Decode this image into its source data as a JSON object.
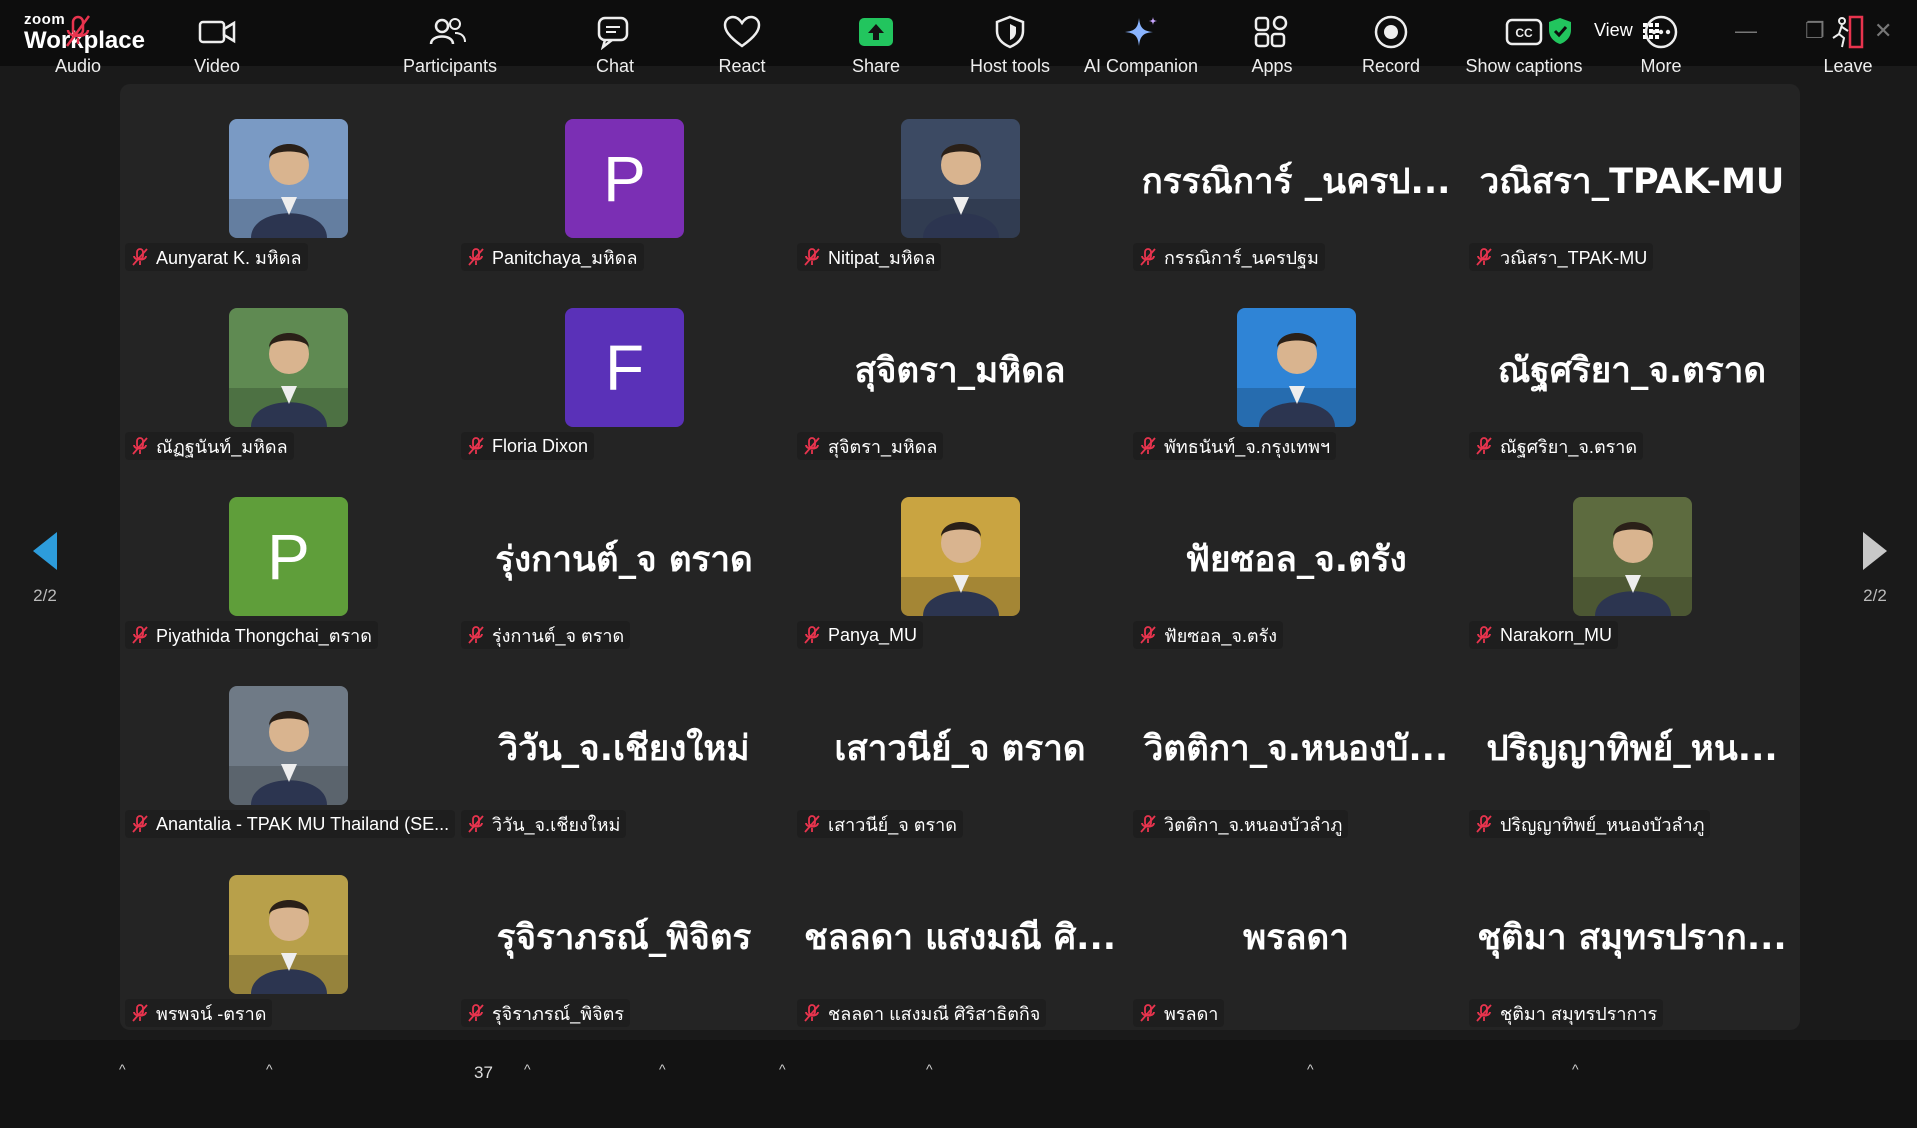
{
  "titlebar": {
    "logo_top": "zoom",
    "logo_bottom": "Workplace",
    "view_label": "View",
    "minimize": "—",
    "maximize": "❐",
    "close": "✕"
  },
  "pager": {
    "left_label": "2/2",
    "right_label": "2/2"
  },
  "participants": [
    {
      "name": "Aunyarat K. มหิดล",
      "display": "photo",
      "photo_color": "#7a9ac4"
    },
    {
      "name": "Panitchaya_มหิดล",
      "display": "letter",
      "letter": "P",
      "color": "#7b2fb4"
    },
    {
      "name": "Nitipat_มหิดล",
      "display": "photo",
      "photo_color": "#3c4a63"
    },
    {
      "name": "กรรณิการ์_นครปฐม",
      "display": "text",
      "big": "กรรณิการ์ _นครป..."
    },
    {
      "name": "วณิสรา_TPAK-MU",
      "display": "text",
      "big": "วณิสรา_TPAK-MU"
    },
    {
      "name": "ณัฏฐนันท์_มหิดล",
      "display": "photo",
      "photo_color": "#5f8a52"
    },
    {
      "name": "Floria Dixon",
      "display": "letter",
      "letter": "F",
      "color": "#5a31b8"
    },
    {
      "name": "สุจิตรา_มหิดล",
      "display": "text",
      "big": "สุจิตรา_มหิดล"
    },
    {
      "name": "พัทธนันท์_จ.กรุงเทพฯ",
      "display": "photo",
      "photo_color": "#2f84d6"
    },
    {
      "name": "ณัฐศริยา_จ.ตราด",
      "display": "text",
      "big": "ณัฐศริยา_จ.ตราด"
    },
    {
      "name": "Piyathida Thongchai_ตราด",
      "display": "letter",
      "letter": "P",
      "color": "#5f9e3a"
    },
    {
      "name": "รุ่งกานต์_จ ตราด",
      "display": "text",
      "big": "รุ่งกานต์_จ ตราด"
    },
    {
      "name": "Panya_MU",
      "display": "photo",
      "photo_color": "#c9a441"
    },
    {
      "name": "ฟัยซอล_จ.ตรัง",
      "display": "text",
      "big": "ฟัยซอล_จ.ตรัง"
    },
    {
      "name": "Narakorn_MU",
      "display": "photo",
      "photo_color": "#5d6b3f"
    },
    {
      "name": "Anantalia - TPAK MU Thailand (SE...",
      "display": "photo",
      "photo_color": "#6f7a86"
    },
    {
      "name": "วิวัน_จ.เชียงใหม่",
      "display": "text",
      "big": "วิวัน_จ.เชียงใหม่"
    },
    {
      "name": "เสาวนีย์_จ ตราด",
      "display": "text",
      "big": "เสาวนีย์_จ ตราด"
    },
    {
      "name": "วิตติกา_จ.หนองบัวลำภู",
      "display": "text",
      "big": "วิตติกา_จ.หนองบั..."
    },
    {
      "name": "ปริญญาทิพย์_หนองบัวลำภู",
      "display": "text",
      "big": "ปริญญาทิพย์_หน..."
    },
    {
      "name": "พรพจน์ -ตราด",
      "display": "photo",
      "photo_color": "#b8a04a"
    },
    {
      "name": "รุจิราภรณ์_พิจิตร",
      "display": "text",
      "big": "รุจิราภรณ์_พิจิตร"
    },
    {
      "name": "ชลลดา แสงมณี ศิริสาธิตกิจ",
      "display": "text",
      "big": "ชลลดา แสงมณี ศิ..."
    },
    {
      "name": "พรลดา",
      "display": "text",
      "big": "พรลดา"
    },
    {
      "name": "ชุติมา สมุทรปราการ",
      "display": "text",
      "big": "ชุติมา สมุทรปราก..."
    }
  ],
  "toolbar": {
    "audio": "Audio",
    "video": "Video",
    "participants": "Participants",
    "participants_count": "37",
    "chat": "Chat",
    "react": "React",
    "share": "Share",
    "host_tools": "Host tools",
    "ai_companion": "AI Companion",
    "apps": "Apps",
    "record": "Record",
    "show_captions": "Show captions",
    "more": "More",
    "leave": "Leave"
  },
  "colors": {
    "share_green": "#22c55e",
    "mute_red": "#e8344e",
    "pager_blue": "#2d9cdb",
    "leave_red": "#e8344e"
  }
}
